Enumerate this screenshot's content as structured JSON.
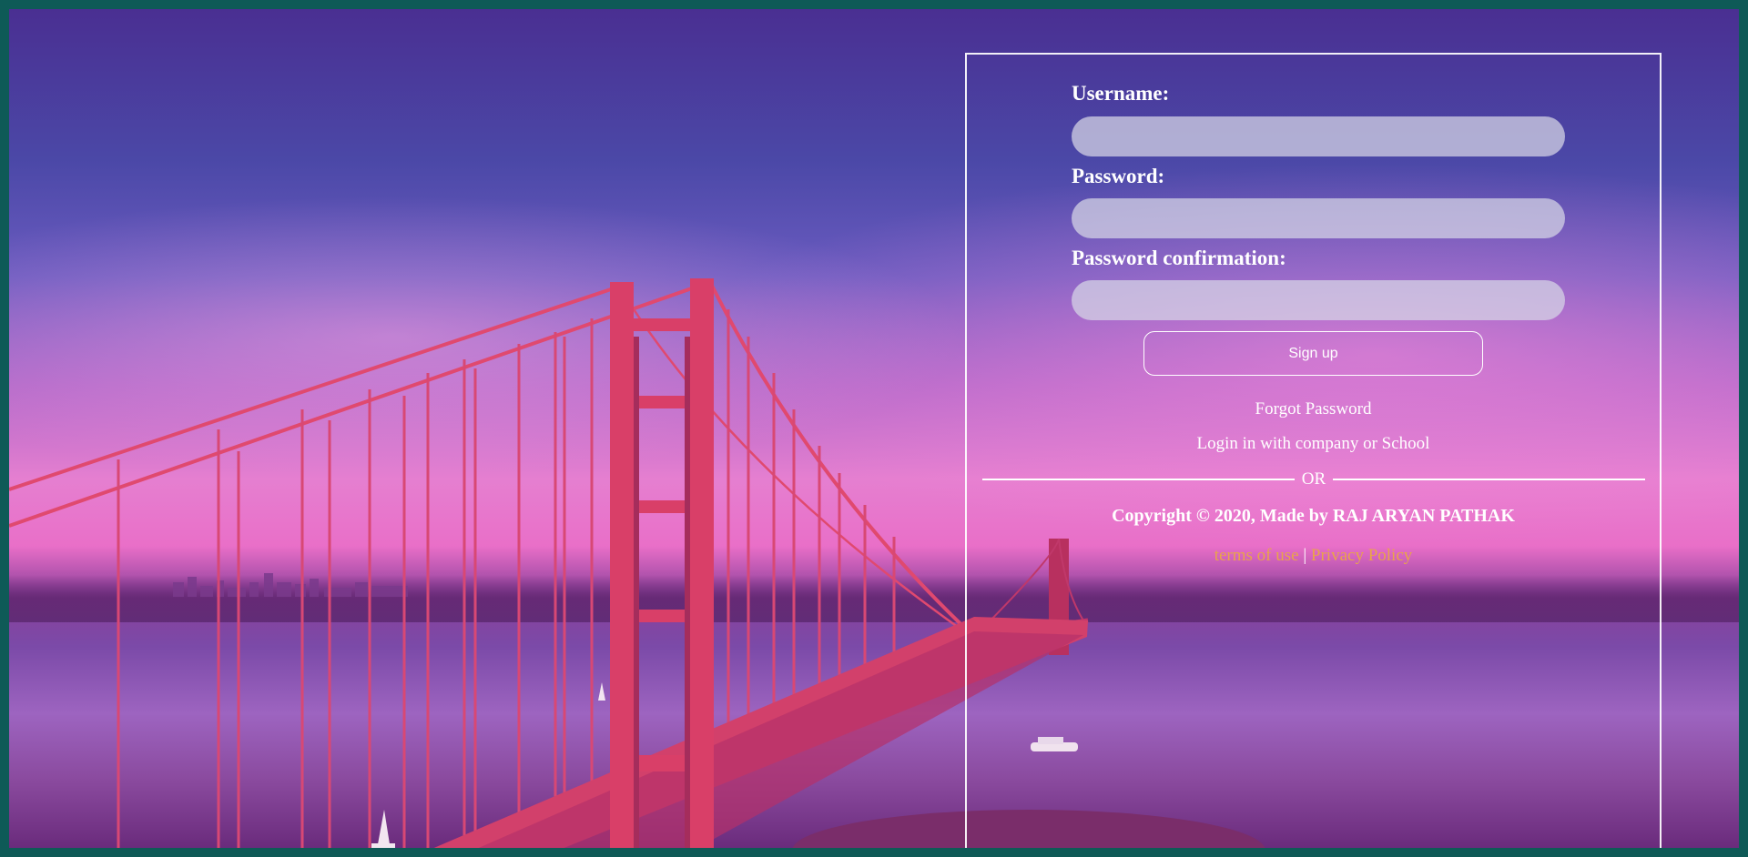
{
  "form": {
    "username_label": "Username:",
    "password_label": "Password:",
    "password_confirmation_label": "Password confirmation:",
    "username_value": "",
    "password_value": "",
    "password_confirmation_value": "",
    "signup_button": "Sign up"
  },
  "links": {
    "forgot_password": "Forgot Password",
    "login_company_school": "Login in with company or School"
  },
  "divider": {
    "text": "OR"
  },
  "footer": {
    "copyright": "Copyright © 2020, Made by RAJ ARYAN PATHAK",
    "terms": "terms of use",
    "separator": "|",
    "privacy": "Privacy Policy"
  },
  "colors": {
    "panel_border": "#ffffff",
    "legal_link": "#e9a44a",
    "frame": "#0e5a57"
  },
  "background": {
    "image_subject": "golden-gate-bridge-sunset"
  }
}
